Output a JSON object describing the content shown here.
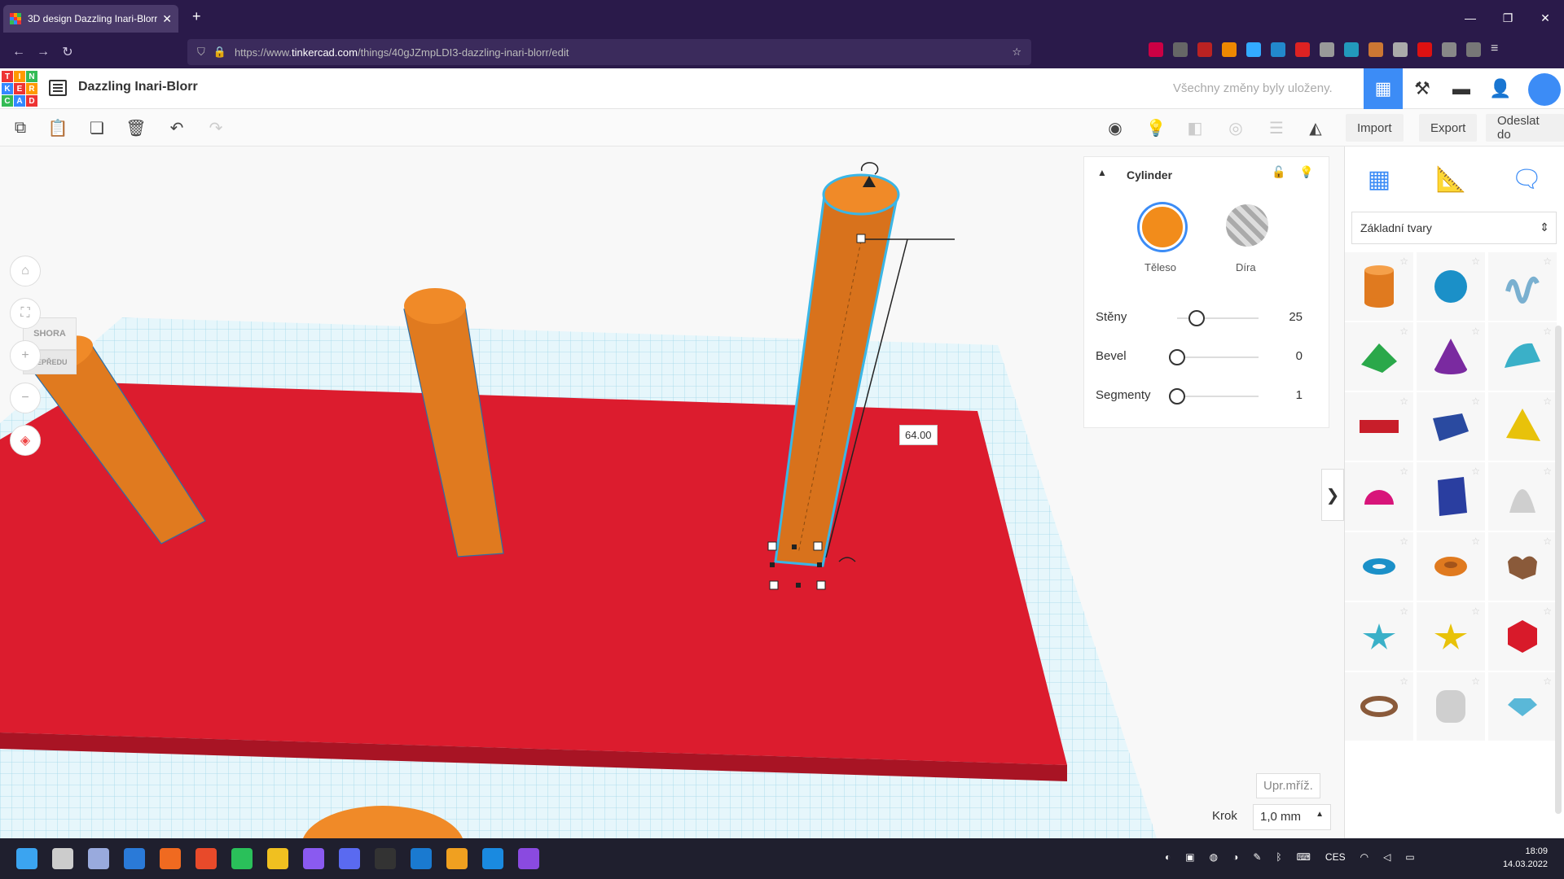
{
  "browser": {
    "tab_title": "3D design Dazzling Inari-Blorr |",
    "url_prefix": "https://www.",
    "url_host": "tinkercad.com",
    "url_path": "/things/40gJZmpLDI3-dazzling-inari-blorr/edit",
    "new_tab": "+",
    "close_tab": "✕"
  },
  "app": {
    "logo_letters": [
      "T",
      "I",
      "N",
      "K",
      "E",
      "R",
      "C",
      "A",
      "D"
    ],
    "design_title": "Dazzling Inari-Blorr",
    "save_status": "Všechny změny byly uloženy."
  },
  "toolbar": {
    "import_label": "Import",
    "export_label": "Export",
    "send_label": "Odeslat do"
  },
  "viewcube": {
    "top": "SHORA",
    "front": "ZEPŘEDU"
  },
  "inspector": {
    "title": "Cylinder",
    "solid_label": "Těleso",
    "hole_label": "Díra",
    "props": [
      {
        "label": "Stěny",
        "value": "25",
        "fraction": 0.25
      },
      {
        "label": "Bevel",
        "value": "0",
        "fraction": 0.0
      },
      {
        "label": "Segmenty",
        "value": "1",
        "fraction": 0.0
      }
    ]
  },
  "viewport": {
    "measure_value": "64.00",
    "grid_button": "Upr.mříž.",
    "snap_label": "Krok",
    "snap_value": "1,0 mm"
  },
  "library": {
    "category": "Základní tvary",
    "shapes": [
      "cylinder",
      "sphere",
      "scribble",
      "roof",
      "cone",
      "round-roof",
      "text",
      "box",
      "pyramid",
      "half-sphere",
      "polygon",
      "paraboloid",
      "torus",
      "tube",
      "heart",
      "star",
      "star-yellow",
      "icosahedron",
      "ring",
      "rounded-box",
      "gem"
    ]
  },
  "taskbar": {
    "time": "18:09",
    "date": "14.03.2022",
    "lang": "CES"
  },
  "colors": {
    "accent": "#3c8cf6",
    "orange": "#f28c1b",
    "red_plate": "#dc1c2e",
    "grid": "#a8e0f0",
    "chrome_bg": "#2a1a4a"
  }
}
